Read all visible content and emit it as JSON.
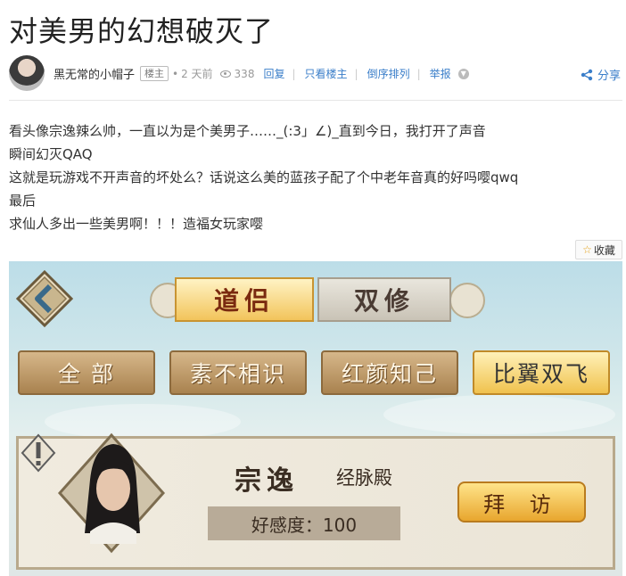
{
  "post": {
    "title": "对美男的幻想破灭了",
    "author": "黑无常的小帽子",
    "author_badge": "楼主",
    "time": "2 天前",
    "views": "338",
    "actions": [
      "回复",
      "只看楼主",
      "倒序排列",
      "举报"
    ],
    "share_label": "分享",
    "favorite_label": "收藏",
    "content_lines": [
      "看头像宗逸辣么帅，一直以为是个美男子……_(:3」∠)_直到今日，我打开了声音",
      "瞬间幻灭QAQ",
      "这就是玩游戏不开声音的坏处么？话说这么美的蓝孩子配了个中老年音真的好吗嘤qwq",
      "最后",
      "求仙人多出一些美男啊！！！造福女玩家嘤"
    ]
  },
  "game": {
    "tabs": [
      "道侣",
      "双修"
    ],
    "active_tab": "道侣",
    "filters": [
      "全 部",
      "素不相识",
      "红颜知己",
      "比翼双飞"
    ],
    "active_filter": "比翼双飞",
    "character": {
      "name": "宗逸",
      "sect": "经脉殿",
      "favor": "好感度：100"
    },
    "visit_label": "拜 访"
  },
  "colors": {
    "link": "#3a7ec9",
    "accent_gold": "#f0c24e"
  }
}
